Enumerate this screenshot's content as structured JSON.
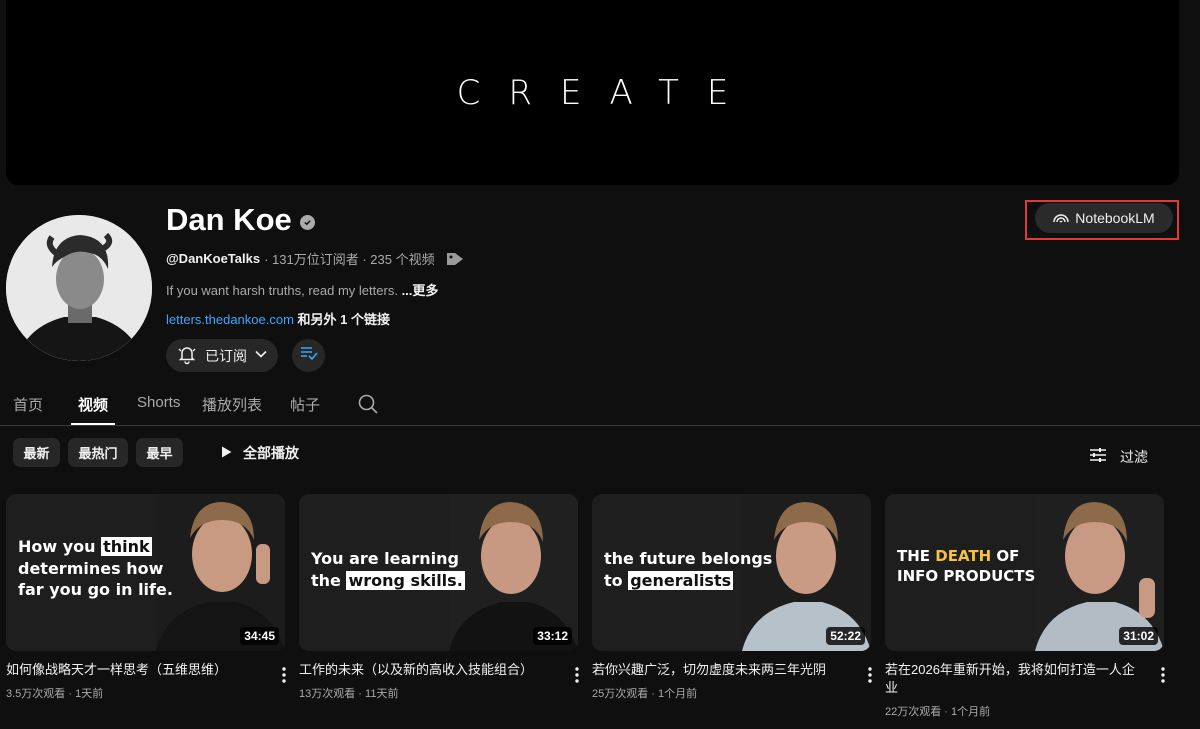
{
  "banner": {
    "text": "CREATE"
  },
  "channel": {
    "name": "Dan Koe",
    "handle": "@DanKoeTalks",
    "stats": "· 131万位订阅者 · 235 个视频",
    "description": "If you want harsh truths, read my letters.",
    "more": "...更多",
    "link_url": "letters.thedankoe.com",
    "link_extra": "和另外 1 个链接"
  },
  "actions": {
    "subscribed_label": "已订阅",
    "notebook_label": "NotebookLM"
  },
  "tabs": [
    {
      "label": "首页"
    },
    {
      "label": "视频"
    },
    {
      "label": "Shorts"
    },
    {
      "label": "播放列表"
    },
    {
      "label": "帖子"
    }
  ],
  "filters": {
    "chips": [
      "最新",
      "最热门",
      "最早"
    ],
    "play_all": "全部播放",
    "filter_label": "过滤"
  },
  "videos": [
    {
      "title": "如何像战略天才一样思考（五维思维）",
      "views": "3.5万次观看",
      "age": "1天前",
      "duration": "34:45",
      "thumb_l1a": "How you ",
      "thumb_l1b": "think",
      "thumb_l2": "determines how",
      "thumb_l3": "far you go in life."
    },
    {
      "title": "工作的未来（以及新的高收入技能组合）",
      "views": "13万次观看",
      "age": "11天前",
      "duration": "33:12",
      "thumb_l1": "You are learning",
      "thumb_l2a": "the ",
      "thumb_l2b": "wrong skills."
    },
    {
      "title": "若你兴趣广泛，切勿虚度未来两三年光阴",
      "views": "25万次观看",
      "age": "1个月前",
      "duration": "52:22",
      "thumb_l1": "the future belongs",
      "thumb_l2a": "to ",
      "thumb_l2b": "generalists"
    },
    {
      "title": "若在2026年重新开始，我将如何打造一人企业",
      "views": "22万次观看",
      "age": "1个月前",
      "duration": "31:02",
      "thumb_l1a": "THE ",
      "thumb_l1b": "DEATH",
      "thumb_l1c": " OF",
      "thumb_l2": "INFO PRODUCTS"
    }
  ],
  "colors": {
    "accent_link": "#3ea6ff",
    "highlight_box": "#e53935",
    "gold": "#f5c242"
  }
}
